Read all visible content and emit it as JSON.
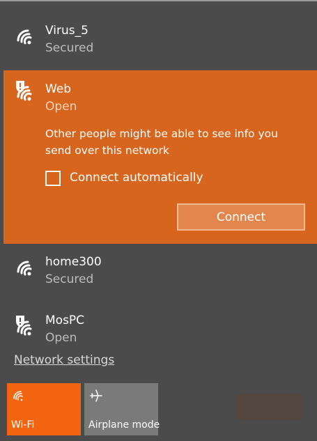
{
  "networks": [
    {
      "name": "Virus_5",
      "status": "Secured",
      "warning": false
    },
    {
      "name": "Web",
      "status": "Open",
      "warning": true,
      "selected": true
    },
    {
      "name": "home300",
      "status": "Secured",
      "warning": false
    },
    {
      "name": "MosPC",
      "status": "Open",
      "warning": true
    }
  ],
  "selected_network": {
    "name": "Web",
    "status": "Open",
    "warning_text": "Other people might be able to see info you send over this network",
    "connect_auto_label": "Connect automatically",
    "connect_auto_checked": false,
    "connect_label": "Connect"
  },
  "network_settings_label": "Network settings",
  "quick_actions": {
    "wifi": {
      "label": "Wi-Fi",
      "active": true
    },
    "airplane": {
      "label": "Airplane mode",
      "active": false
    }
  },
  "colors": {
    "accent": "#d7651d",
    "wifi_tile": "#f2640f",
    "airplane_tile": "#7a7a7a",
    "background": "#4b4b4b"
  }
}
